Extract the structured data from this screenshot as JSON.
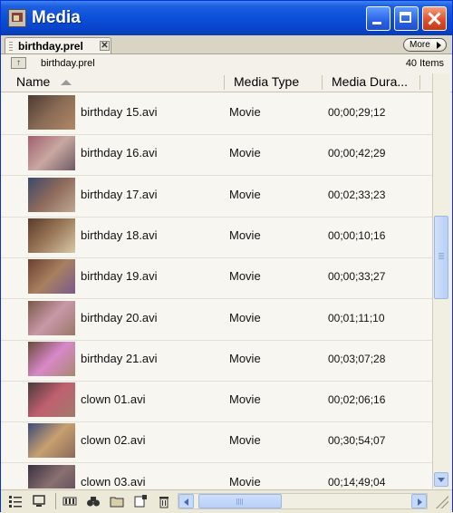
{
  "window": {
    "title": "Media"
  },
  "tab": {
    "label": "birthday.prel",
    "close_glyph": "✕",
    "more_label": "More"
  },
  "path": {
    "name": "birthday.prel",
    "item_count": "40 Items"
  },
  "columns": {
    "name": "Name",
    "type": "Media Type",
    "duration": "Media Dura..."
  },
  "rows": [
    {
      "name": "birthday 15.avi",
      "type": "Movie",
      "duration": "00;00;29;12",
      "thumb_colors": [
        "#4C3A30",
        "#8A6B55",
        "#B08866"
      ]
    },
    {
      "name": "birthday 16.avi",
      "type": "Movie",
      "duration": "00;00;42;29",
      "thumb_colors": [
        "#A06070",
        "#C9A8A0",
        "#6E5A66"
      ]
    },
    {
      "name": "birthday 17.avi",
      "type": "Movie",
      "duration": "00;02;33;23",
      "thumb_colors": [
        "#3C4A6A",
        "#8E6A5C",
        "#C0A890"
      ]
    },
    {
      "name": "birthday 18.avi",
      "type": "Movie",
      "duration": "00;00;10;16",
      "thumb_colors": [
        "#5A3A2A",
        "#9C7A5A",
        "#D8C8A8"
      ]
    },
    {
      "name": "birthday 19.avi",
      "type": "Movie",
      "duration": "00;00;33;27",
      "thumb_colors": [
        "#6A4030",
        "#A88060",
        "#7A5A8A"
      ]
    },
    {
      "name": "birthday 20.avi",
      "type": "Movie",
      "duration": "00;01;11;10",
      "thumb_colors": [
        "#7A5A4A",
        "#C898A8",
        "#9A7868"
      ]
    },
    {
      "name": "birthday 21.avi",
      "type": "Movie",
      "duration": "00;03;07;28",
      "thumb_colors": [
        "#6A4A3A",
        "#D888C8",
        "#A88870"
      ]
    },
    {
      "name": "clown 01.avi",
      "type": "Movie",
      "duration": "00;02;06;16",
      "thumb_colors": [
        "#4A3A3A",
        "#C06070",
        "#A07A6A"
      ]
    },
    {
      "name": "clown 02.avi",
      "type": "Movie",
      "duration": "00;30;54;07",
      "thumb_colors": [
        "#3A4A7A",
        "#C8A070",
        "#8A6A5A"
      ]
    },
    {
      "name": "clown 03.avi",
      "type": "Movie",
      "duration": "00;14;49;04",
      "thumb_colors": [
        "#3A3040",
        "#8A7070",
        "#5A4A5A"
      ]
    }
  ],
  "toolbar_icons": [
    "list-view-icon",
    "icon-view-icon",
    "automate-to-sequence-icon",
    "find-icon",
    "new-bin-icon",
    "new-item-icon",
    "clear-icon"
  ],
  "colors": {
    "titlebar": "#0A4FD8",
    "panel": "#F3F1EA",
    "scroll_accent": "#C5D9FB",
    "close_button": "#E0502A"
  }
}
